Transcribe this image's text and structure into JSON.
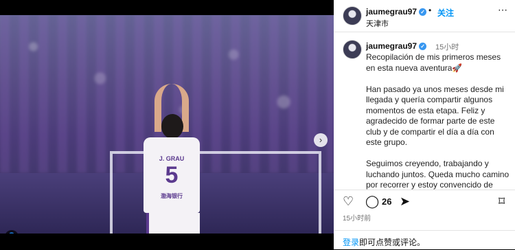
{
  "header": {
    "username": "jaumegrau97",
    "separator": "•",
    "follow_label": "关注",
    "location": "天津市",
    "more_icon": "more-horizontal-icon"
  },
  "media": {
    "jersey_name": "J. GRAU",
    "jersey_number": "5",
    "sponsor": "渤海银行",
    "next_icon": "chevron-right-icon",
    "tag_icon": "user-tag-icon"
  },
  "caption": {
    "username": "jaumegrau97",
    "time": "15小时",
    "text": "Recopilación de mis primeros meses en esta nueva aventura🚀\n\nHan pasado ya unos meses desde mi llegada y quería compartir algunos momentos de esta etapa. Feliz y agradecido de formar parte de este club y de compartir el día a día con este grupo.\n\nSeguimos creyendo, trabajando y luchando juntos. Queda mucho camino por recorrer y estoy convencido de que, con unidad"
  },
  "actions": {
    "comment_count": "26",
    "post_time": "15小时前"
  },
  "login": {
    "link": "登录",
    "rest": "即可点赞或评论。"
  },
  "colors": {
    "accent": "#0095f6",
    "verified": "#3897f0",
    "team_purple": "#5b3a8e"
  }
}
